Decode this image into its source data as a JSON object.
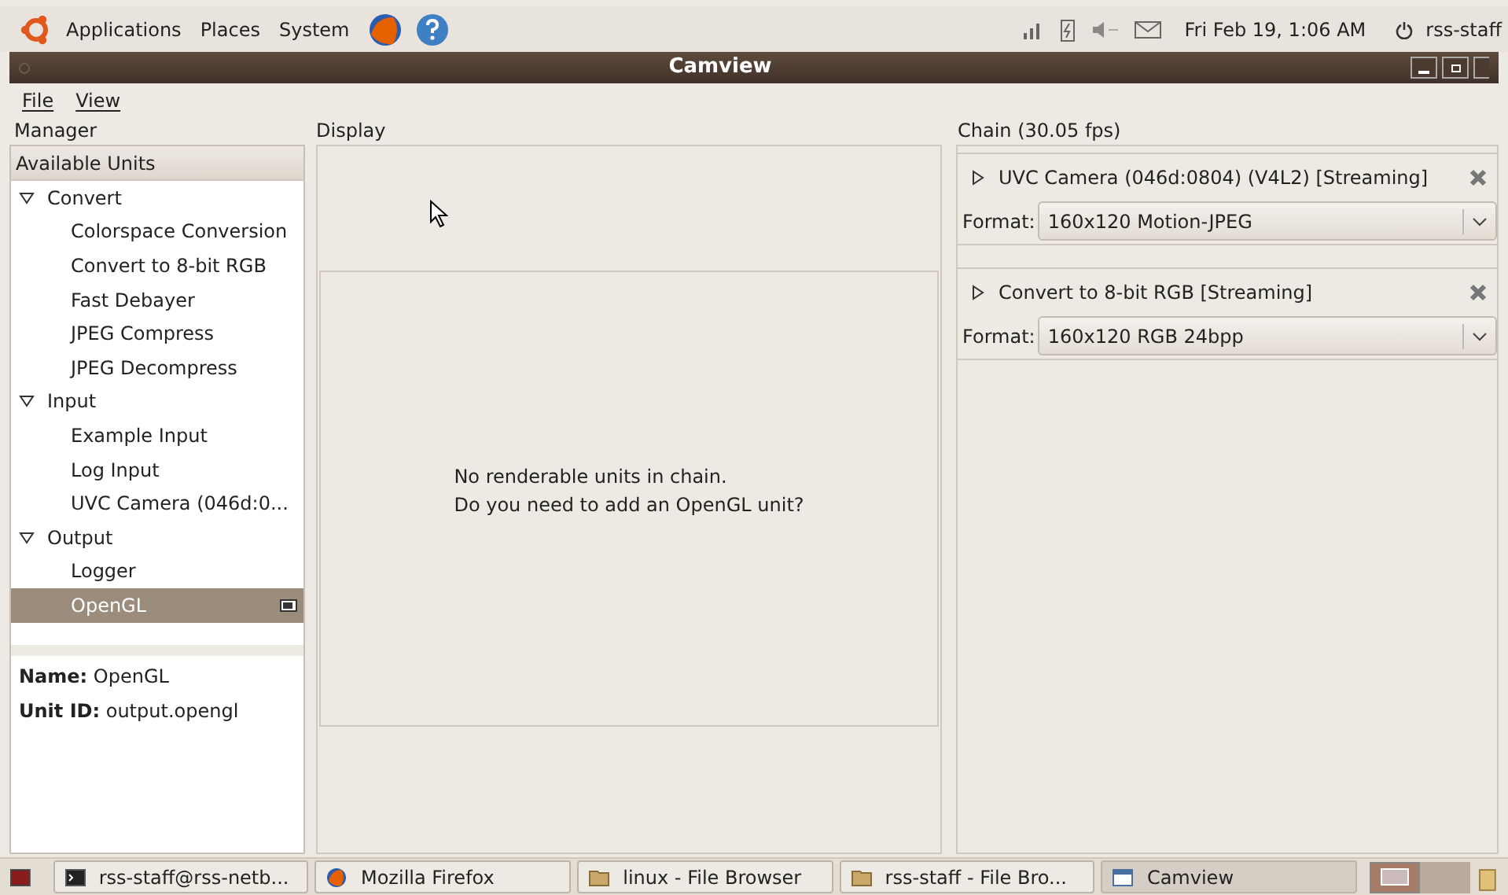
{
  "top_panel": {
    "menus": [
      "Applications",
      "Places",
      "System"
    ],
    "clock": "Fri Feb 19,  1:06 AM",
    "user": "rss-staff"
  },
  "window": {
    "title": "Camview"
  },
  "menu_bar": [
    "File",
    "View"
  ],
  "manager": {
    "title": "Manager",
    "header": "Available Units",
    "groups": [
      {
        "label": "Convert",
        "expanded": true,
        "children": [
          {
            "label": "Colorspace Conversion",
            "selected": false
          },
          {
            "label": "Convert to 8-bit RGB",
            "selected": false
          },
          {
            "label": "Fast Debayer",
            "selected": false
          },
          {
            "label": "JPEG Compress",
            "selected": false
          },
          {
            "label": "JPEG Decompress",
            "selected": false
          }
        ]
      },
      {
        "label": "Input",
        "expanded": true,
        "children": [
          {
            "label": "Example Input",
            "selected": false
          },
          {
            "label": "Log Input",
            "selected": false
          },
          {
            "label": "UVC Camera (046d:0...",
            "selected": false
          }
        ]
      },
      {
        "label": "Output",
        "expanded": true,
        "children": [
          {
            "label": "Logger",
            "selected": false
          },
          {
            "label": "OpenGL",
            "selected": true
          }
        ]
      }
    ],
    "details": [
      {
        "key": "Name:",
        "value": "OpenGL"
      },
      {
        "key": "Unit ID:",
        "value": "output.opengl"
      }
    ]
  },
  "display": {
    "title": "Display",
    "message": [
      "No renderable units in chain.",
      "Do you need to add an OpenGL unit?"
    ]
  },
  "chain": {
    "title": "Chain (30.05 fps)",
    "units": [
      {
        "title": "UVC Camera (046d:0804) (V4L2) [Streaming]",
        "expanded": false,
        "format_label": "Format:",
        "format": "160x120 Motion-JPEG"
      },
      {
        "title": "Convert to 8-bit RGB [Streaming]",
        "expanded": false,
        "format_label": "Format:",
        "format": "160x120 RGB 24bpp"
      }
    ]
  },
  "taskbar": [
    {
      "label": "rss-staff@rss-netb...",
      "kind": "terminal",
      "selected": false
    },
    {
      "label": "Mozilla Firefox",
      "kind": "browser",
      "selected": false
    },
    {
      "label": "linux - File Browser",
      "kind": "folder",
      "selected": false
    },
    {
      "label": "rss-staff - File Bro...",
      "kind": "folder",
      "selected": false
    },
    {
      "label": "Camview",
      "kind": "window",
      "selected": true
    }
  ]
}
